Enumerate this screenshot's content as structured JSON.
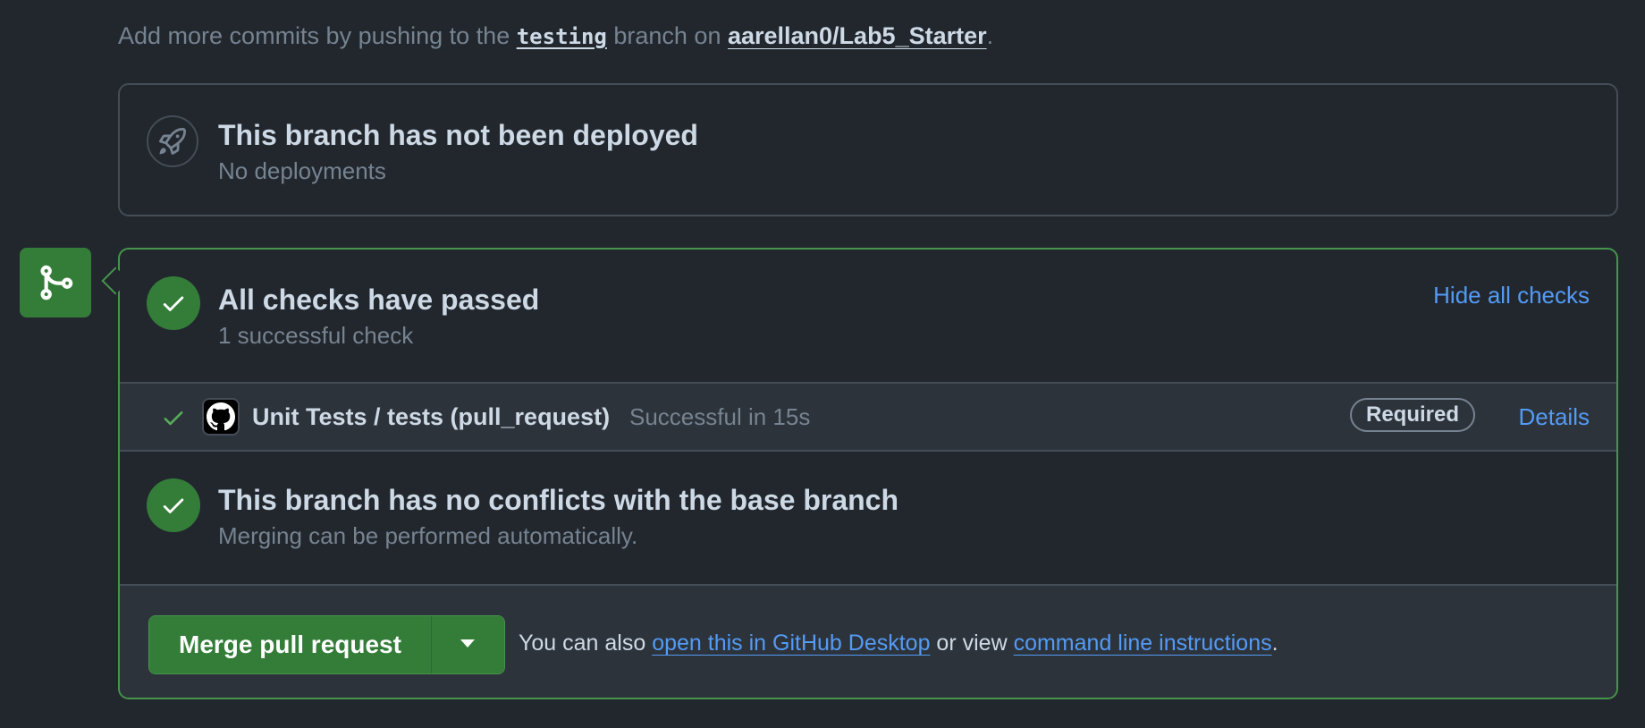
{
  "hint": {
    "prefix": "Add more commits by pushing to the ",
    "branch": "testing",
    "middle": " branch on ",
    "repo": "aarellan0/Lab5_Starter",
    "suffix": "."
  },
  "deployment": {
    "icon": "rocket-icon",
    "title": "This branch has not been deployed",
    "subtitle": "No deployments"
  },
  "checks": {
    "icon": "check-icon",
    "title": "All checks have passed",
    "subtitle": "1 successful check",
    "toggle_label": "Hide all checks",
    "items": [
      {
        "name": "Unit Tests / tests (pull_request)",
        "status": "Successful in 15s",
        "badge": "Required",
        "details_label": "Details"
      }
    ]
  },
  "conflicts": {
    "title": "This branch has no conflicts with the base branch",
    "subtitle": "Merging can be performed automatically."
  },
  "merge": {
    "button_label": "Merge pull request",
    "hint_prefix": "You can also ",
    "desktop_link": "open this in GitHub Desktop",
    "hint_middle": " or view ",
    "cli_link": "command line instructions",
    "hint_suffix": "."
  },
  "colors": {
    "background": "#22272e",
    "success": "#347d39",
    "link": "#539bf5",
    "border": "#444c56"
  }
}
